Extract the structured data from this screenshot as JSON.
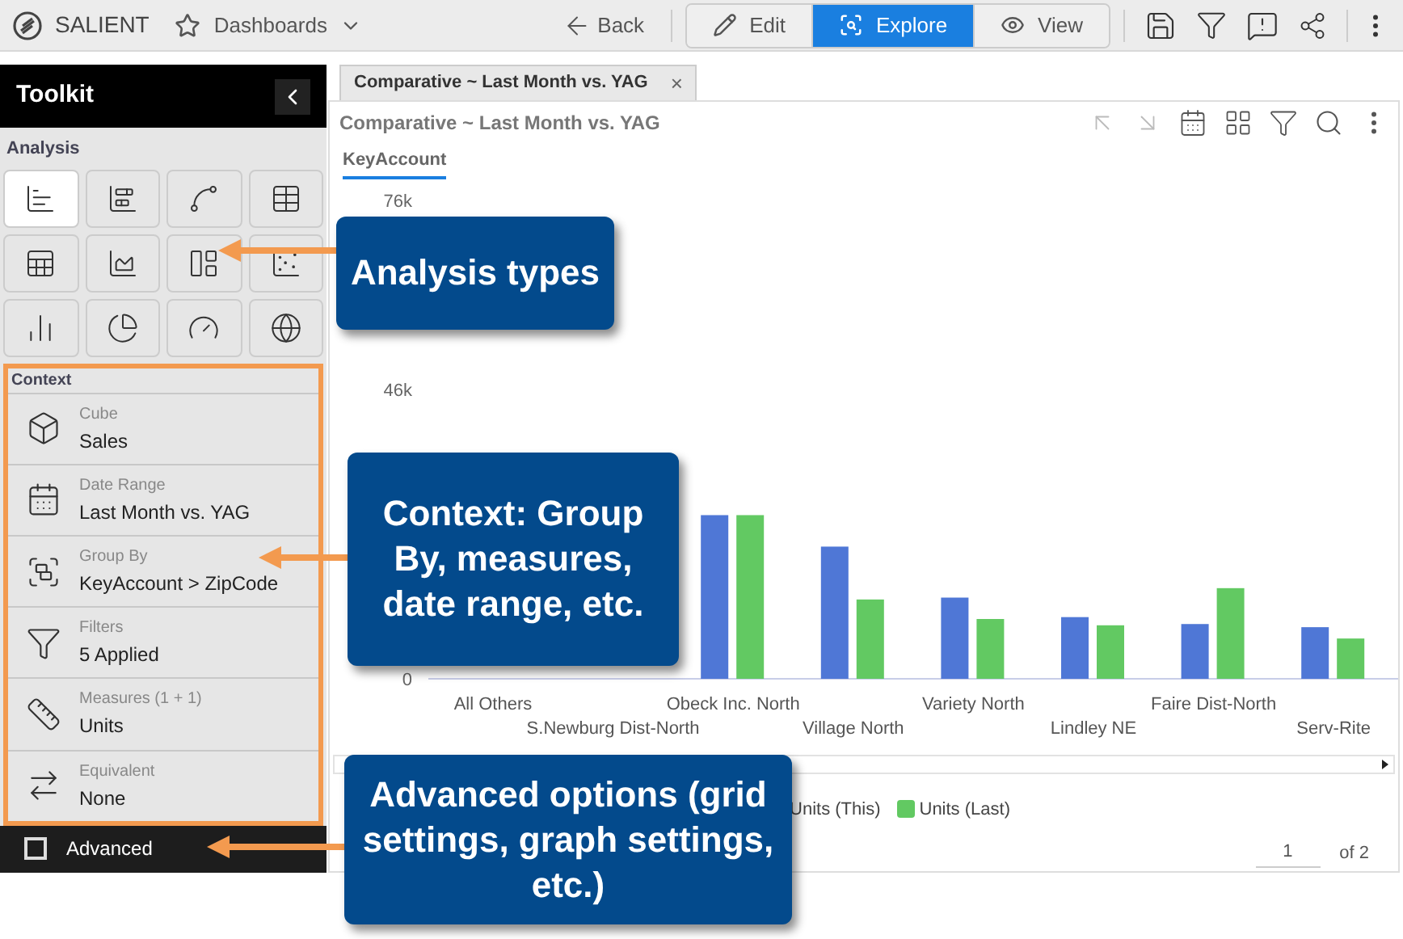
{
  "topbar": {
    "logo": "SALIENT",
    "dashboards": "Dashboards",
    "back": "Back",
    "modes": [
      {
        "label": "Edit",
        "kind": "edit",
        "selected": false
      },
      {
        "label": "Explore",
        "kind": "explore",
        "selected": true
      },
      {
        "label": "View",
        "kind": "view",
        "selected": false
      }
    ]
  },
  "toolkit": {
    "title": "Toolkit",
    "analysis_label": "Analysis",
    "analysis_types": [
      {
        "kind": "bar",
        "selected": true
      },
      {
        "kind": "bar-stacked",
        "selected": false
      },
      {
        "kind": "line",
        "selected": false
      },
      {
        "kind": "table",
        "selected": false
      },
      {
        "kind": "sheet",
        "selected": false
      },
      {
        "kind": "area",
        "selected": false
      },
      {
        "kind": "layout",
        "selected": false
      },
      {
        "kind": "scatter",
        "selected": false
      },
      {
        "kind": "step",
        "selected": false
      },
      {
        "kind": "pie",
        "selected": false
      },
      {
        "kind": "gauge",
        "selected": false
      },
      {
        "kind": "map",
        "selected": false
      }
    ],
    "context_label": "Context",
    "context": [
      {
        "kind": "cube",
        "label": "Cube",
        "value": "Sales"
      },
      {
        "kind": "date",
        "label": "Date Range",
        "value": "Last Month vs. YAG"
      },
      {
        "kind": "group",
        "label": "Group By",
        "value": "KeyAccount > ZipCode"
      },
      {
        "kind": "filter",
        "label": "Filters",
        "value": "5 Applied"
      },
      {
        "kind": "measure",
        "label": "Measures (1 + 1)",
        "value": "Units"
      },
      {
        "kind": "equivalent",
        "label": "Equivalent",
        "value": "None"
      }
    ],
    "advanced": {
      "label": "Advanced",
      "checked": false
    }
  },
  "tab": {
    "title": "Comparative ~ Last Month vs. YAG",
    "close": "×"
  },
  "panel": {
    "title": "Comparative ~ Last Month vs. YAG",
    "dimension_tabs": [
      {
        "label": "KeyAccount",
        "selected": true
      }
    ],
    "chart_data": {
      "type": "bar",
      "categories": [
        "All Others",
        "S.Newburg Dist-North",
        "Obeck Inc. North",
        "Village North",
        "Variety North",
        "Lindley NE",
        "Faire Dist-North",
        "Serv-Rite"
      ],
      "series": [
        {
          "name": "Units (This)",
          "color": "#4f77d6",
          "values": [
            null,
            null,
            26000,
            21000,
            12900,
            9800,
            8700,
            8200
          ]
        },
        {
          "name": "Units (Last)",
          "color": "#62c962",
          "values": [
            null,
            null,
            26000,
            12600,
            9500,
            8500,
            14400,
            6400
          ]
        }
      ],
      "ylim": [
        0,
        76000
      ],
      "yticks": [
        {
          "value": 0,
          "label": "0"
        },
        {
          "value": 46000,
          "label": "46k"
        },
        {
          "value": 76000,
          "label": "76k"
        }
      ]
    },
    "pager": {
      "page": "1",
      "total": "of 2"
    }
  },
  "callouts": [
    {
      "kind": "analysis",
      "text": "Analysis types"
    },
    {
      "kind": "context",
      "text": "Context: Group By, measures, date range, etc."
    },
    {
      "kind": "advanced",
      "text": "Advanced options (grid settings, graph settings, etc.)"
    }
  ]
}
